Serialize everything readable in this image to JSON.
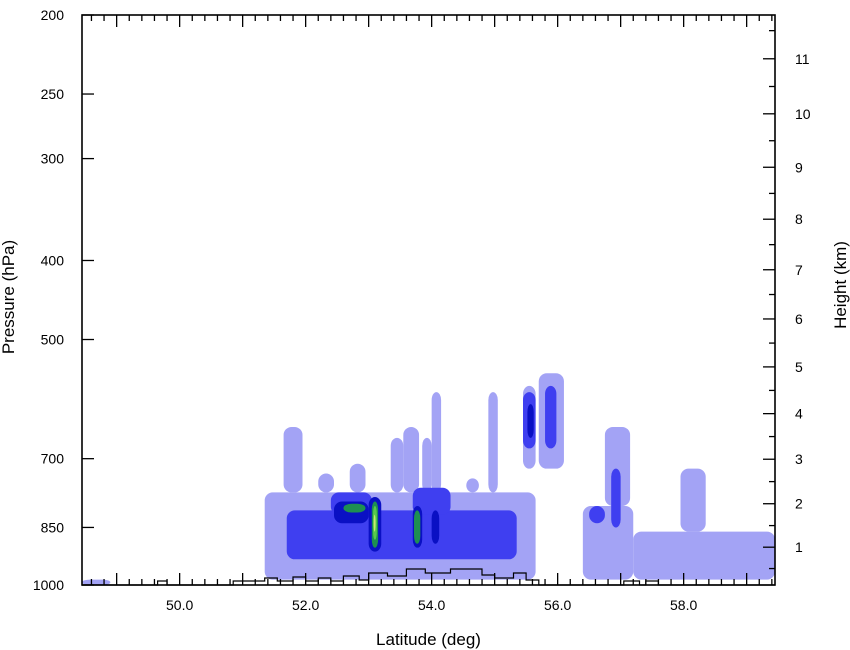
{
  "chart_data": {
    "type": "heatmap",
    "title": "",
    "xlabel": "Latitude (deg)",
    "ylabel_left": "Pressure (hPa)",
    "ylabel_right": "Height (km)",
    "xlim": [
      48.45,
      59.45
    ],
    "ylim_pressure": [
      1000,
      200
    ],
    "left_scale": "log-pressure",
    "x_ticks": [
      "50.0",
      "52.0",
      "54.0",
      "56.0",
      "58.0"
    ],
    "left_ticks": [
      "200",
      "250",
      "300",
      "400",
      "500",
      "700",
      "850",
      "1000"
    ],
    "right_ticks": [
      "1",
      "2",
      "3",
      "4",
      "5",
      "6",
      "7",
      "8",
      "9",
      "10",
      "11"
    ],
    "legend": "none",
    "grid": false,
    "colors": {
      "level1": "#a3a3f5",
      "level2": "#3f3ff0",
      "level3": "#0a10c4",
      "level4": "#1e8f52",
      "level5": "#5ac94e",
      "level6": "#c8ec72",
      "terrain_line": "#000000",
      "axis": "#000000"
    },
    "regions": [
      {
        "level": 1,
        "lat": [
          48.45,
          48.9
        ],
        "p": [
          1000,
          985
        ]
      },
      {
        "level": 1,
        "lat": [
          51.35,
          55.65
        ],
        "p": [
          985,
          770
        ]
      },
      {
        "level": 1,
        "lat": [
          51.65,
          51.95
        ],
        "p": [
          770,
          640
        ]
      },
      {
        "level": 1,
        "lat": [
          52.2,
          52.45
        ],
        "p": [
          770,
          730
        ]
      },
      {
        "level": 1,
        "lat": [
          52.7,
          52.95
        ],
        "p": [
          770,
          710
        ]
      },
      {
        "level": 1,
        "lat": [
          53.35,
          53.55
        ],
        "p": [
          770,
          660
        ]
      },
      {
        "level": 1,
        "lat": [
          53.55,
          53.8
        ],
        "p": [
          770,
          640
        ]
      },
      {
        "level": 1,
        "lat": [
          53.85,
          54.0
        ],
        "p": [
          770,
          660
        ]
      },
      {
        "level": 1,
        "lat": [
          54.0,
          54.15
        ],
        "p": [
          770,
          580
        ]
      },
      {
        "level": 1,
        "lat": [
          54.55,
          54.75
        ],
        "p": [
          770,
          740
        ]
      },
      {
        "level": 1,
        "lat": [
          54.9,
          55.05
        ],
        "p": [
          770,
          580
        ]
      },
      {
        "level": 1,
        "lat": [
          55.45,
          55.65
        ],
        "p": [
          720,
          570
        ]
      },
      {
        "level": 1,
        "lat": [
          55.7,
          56.1
        ],
        "p": [
          720,
          550
        ]
      },
      {
        "level": 1,
        "lat": [
          56.4,
          57.2
        ],
        "p": [
          985,
          800
        ]
      },
      {
        "level": 1,
        "lat": [
          56.75,
          57.15
        ],
        "p": [
          800,
          640
        ]
      },
      {
        "level": 1,
        "lat": [
          57.2,
          59.45
        ],
        "p": [
          985,
          860
        ]
      },
      {
        "level": 1,
        "lat": [
          57.95,
          58.35
        ],
        "p": [
          860,
          720
        ]
      },
      {
        "level": 2,
        "lat": [
          51.7,
          55.35
        ],
        "p": [
          930,
          810
        ]
      },
      {
        "level": 2,
        "lat": [
          52.4,
          53.05
        ],
        "p": [
          820,
          770
        ]
      },
      {
        "level": 2,
        "lat": [
          53.7,
          54.3
        ],
        "p": [
          820,
          760
        ]
      },
      {
        "level": 2,
        "lat": [
          55.45,
          55.65
        ],
        "p": [
          680,
          580
        ]
      },
      {
        "level": 2,
        "lat": [
          55.8,
          55.98
        ],
        "p": [
          680,
          570
        ]
      },
      {
        "level": 2,
        "lat": [
          56.5,
          56.75
        ],
        "p": [
          840,
          800
        ]
      },
      {
        "level": 2,
        "lat": [
          56.85,
          57.0
        ],
        "p": [
          850,
          720
        ]
      },
      {
        "level": 3,
        "lat": [
          52.45,
          53.0
        ],
        "p": [
          840,
          790
        ]
      },
      {
        "level": 3,
        "lat": [
          53.0,
          53.2
        ],
        "p": [
          910,
          780
        ]
      },
      {
        "level": 3,
        "lat": [
          53.7,
          53.85
        ],
        "p": [
          900,
          800
        ]
      },
      {
        "level": 3,
        "lat": [
          54.0,
          54.12
        ],
        "p": [
          890,
          810
        ]
      },
      {
        "level": 3,
        "lat": [
          55.52,
          55.62
        ],
        "p": [
          660,
          600
        ]
      },
      {
        "level": 4,
        "lat": [
          52.6,
          52.95
        ],
        "p": [
          815,
          795
        ]
      },
      {
        "level": 4,
        "lat": [
          53.05,
          53.15
        ],
        "p": [
          900,
          790
        ]
      },
      {
        "level": 4,
        "lat": [
          53.72,
          53.82
        ],
        "p": [
          890,
          810
        ]
      },
      {
        "level": 5,
        "lat": [
          53.07,
          53.13
        ],
        "p": [
          880,
          800
        ]
      },
      {
        "level": 6,
        "lat": [
          53.08,
          53.11
        ],
        "p": [
          860,
          820
        ]
      }
    ],
    "terrain_baseline_hPa": 1000
  }
}
